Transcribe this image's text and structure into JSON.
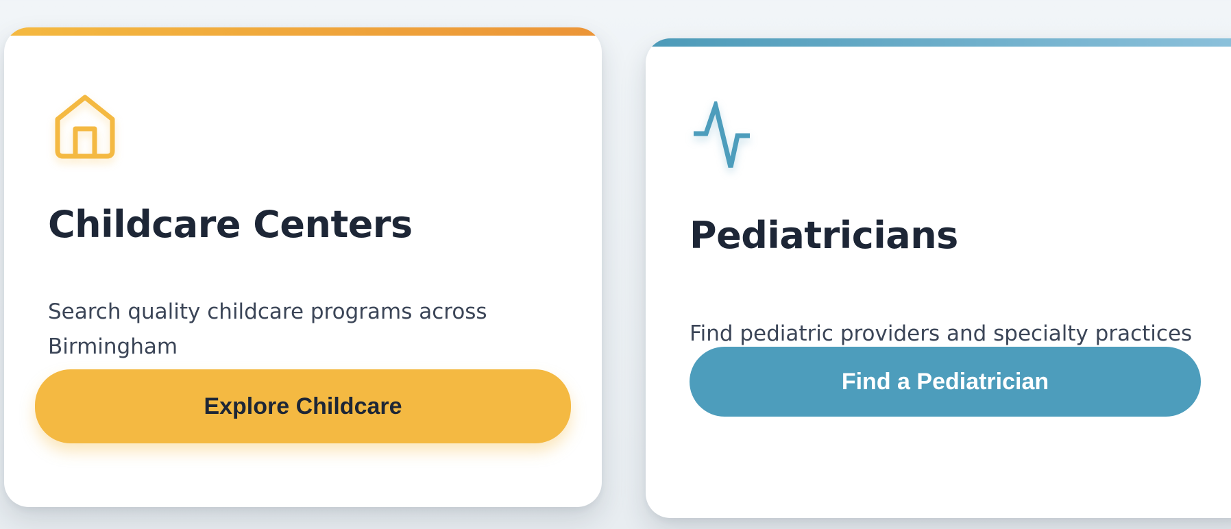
{
  "cards": [
    {
      "icon": "house-icon",
      "accent_color": "#f4b942",
      "title": "Childcare Centers",
      "description": "Search quality childcare programs across Birmingham",
      "button_label": "Explore Childcare"
    },
    {
      "icon": "heartbeat-pulse-icon",
      "accent_color": "#4d9dbc",
      "title": "Pediatricians",
      "description": "Find pediatric providers and specialty practices",
      "button_label": "Find a Pediatrician"
    }
  ]
}
